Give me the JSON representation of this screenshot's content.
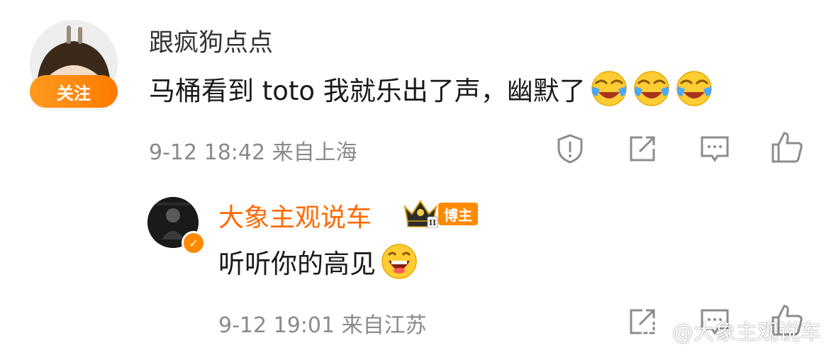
{
  "comment": {
    "follow_label": "关注",
    "username": "跟疯狗点点",
    "text": "马桶看到 toto 我就乐出了声，幽默了",
    "emojis": [
      "laugh-cry-emoji",
      "laugh-cry-emoji",
      "laugh-cry-emoji"
    ],
    "meta": "9-12 18:42 来自上海",
    "actions": [
      "report-icon",
      "share-icon",
      "comment-icon",
      "like-icon"
    ]
  },
  "reply": {
    "username": "大象主观说车",
    "verified_icon": "v-verified-icon",
    "crown_icon": "crown-icon",
    "crown_level": "II",
    "badge": "博主",
    "text": "听听你的高见",
    "emoji": "big-grin-emoji",
    "meta": "9-12 19:01 来自江苏",
    "actions": [
      "share-icon",
      "comment-icon",
      "like-icon"
    ]
  },
  "watermark": {
    "icon": "weibo-logo-icon",
    "text": "@大象主观说车"
  },
  "colors": {
    "accent_orange": "#ff7a00",
    "username_orange": "#ff6a00",
    "meta_gray": "#8a8a8a",
    "icon_gray": "#8c8c8c",
    "emoji_yellow": "#ffcc33"
  }
}
